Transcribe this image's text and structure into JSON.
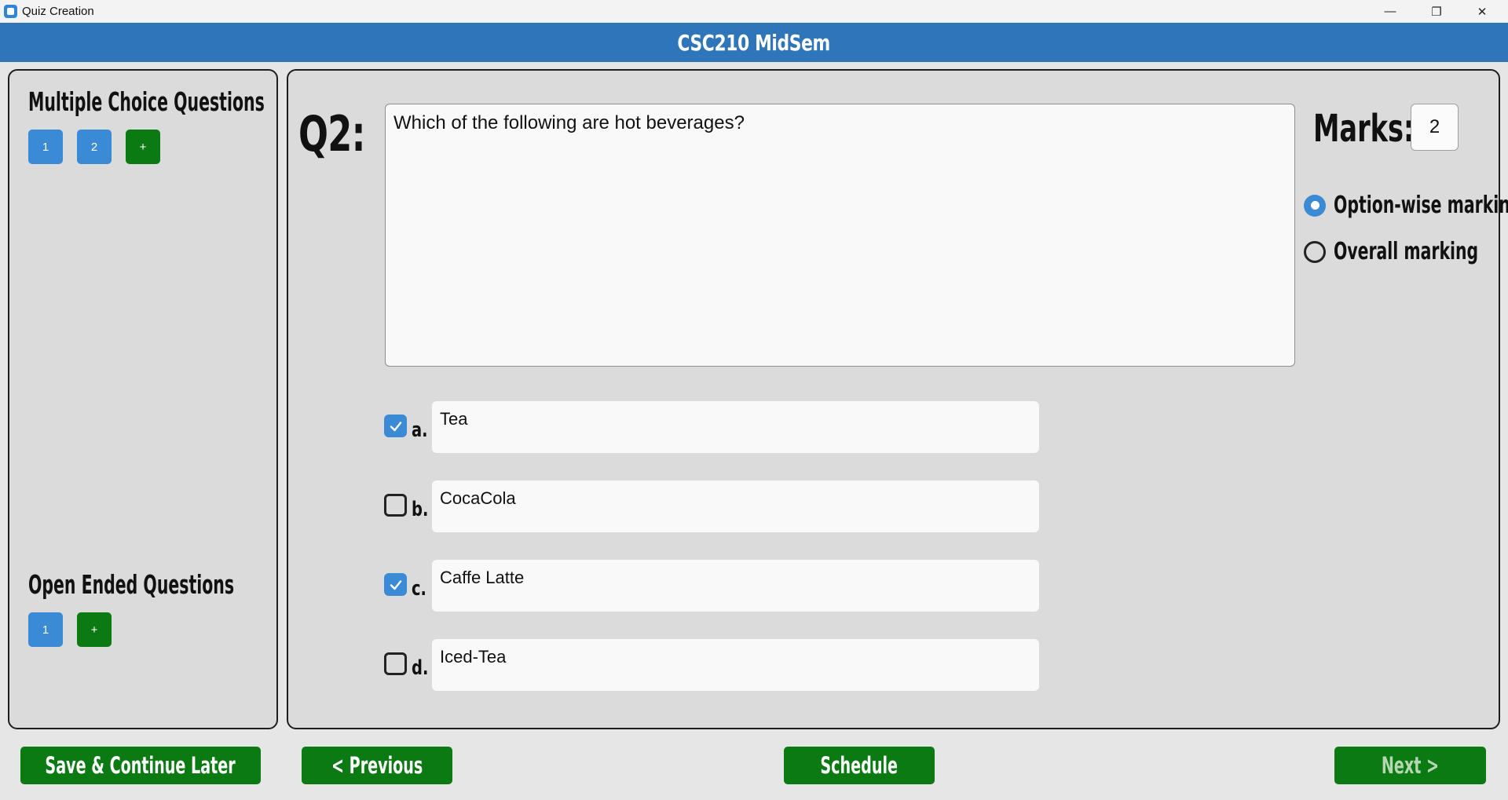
{
  "window": {
    "title": "Quiz Creation",
    "minimize_glyph": "—",
    "restore_glyph": "❐",
    "close_glyph": "✕"
  },
  "header": {
    "title": "CSC210 MidSem"
  },
  "sidebar": {
    "mcq_title": "Multiple Choice Questions",
    "mcq_buttons": [
      "1",
      "2"
    ],
    "mcq_add": "+",
    "open_title": "Open Ended Questions",
    "open_buttons": [
      "1"
    ],
    "open_add": "+"
  },
  "question": {
    "label": "Q2:",
    "text": "Which of the following are hot beverages?",
    "marks_label": "Marks:",
    "marks_value": "2",
    "marking_options": [
      {
        "label": "Option-wise marking",
        "selected": true
      },
      {
        "label": "Overall marking",
        "selected": false
      }
    ],
    "options": [
      {
        "letter": "a.",
        "text": "Tea",
        "checked": true
      },
      {
        "letter": "b.",
        "text": "CocaCola",
        "checked": false
      },
      {
        "letter": "c.",
        "text": "Caffe Latte",
        "checked": true
      },
      {
        "letter": "d.",
        "text": "Iced-Tea",
        "checked": false
      }
    ]
  },
  "footer": {
    "save_label": "Save & Continue Later",
    "previous_label": "< Previous",
    "schedule_label": "Schedule",
    "next_label": "Next >"
  },
  "colors": {
    "header": "#2e76b9",
    "accent_blue": "#3a8ad6",
    "green": "#0c7a12"
  }
}
